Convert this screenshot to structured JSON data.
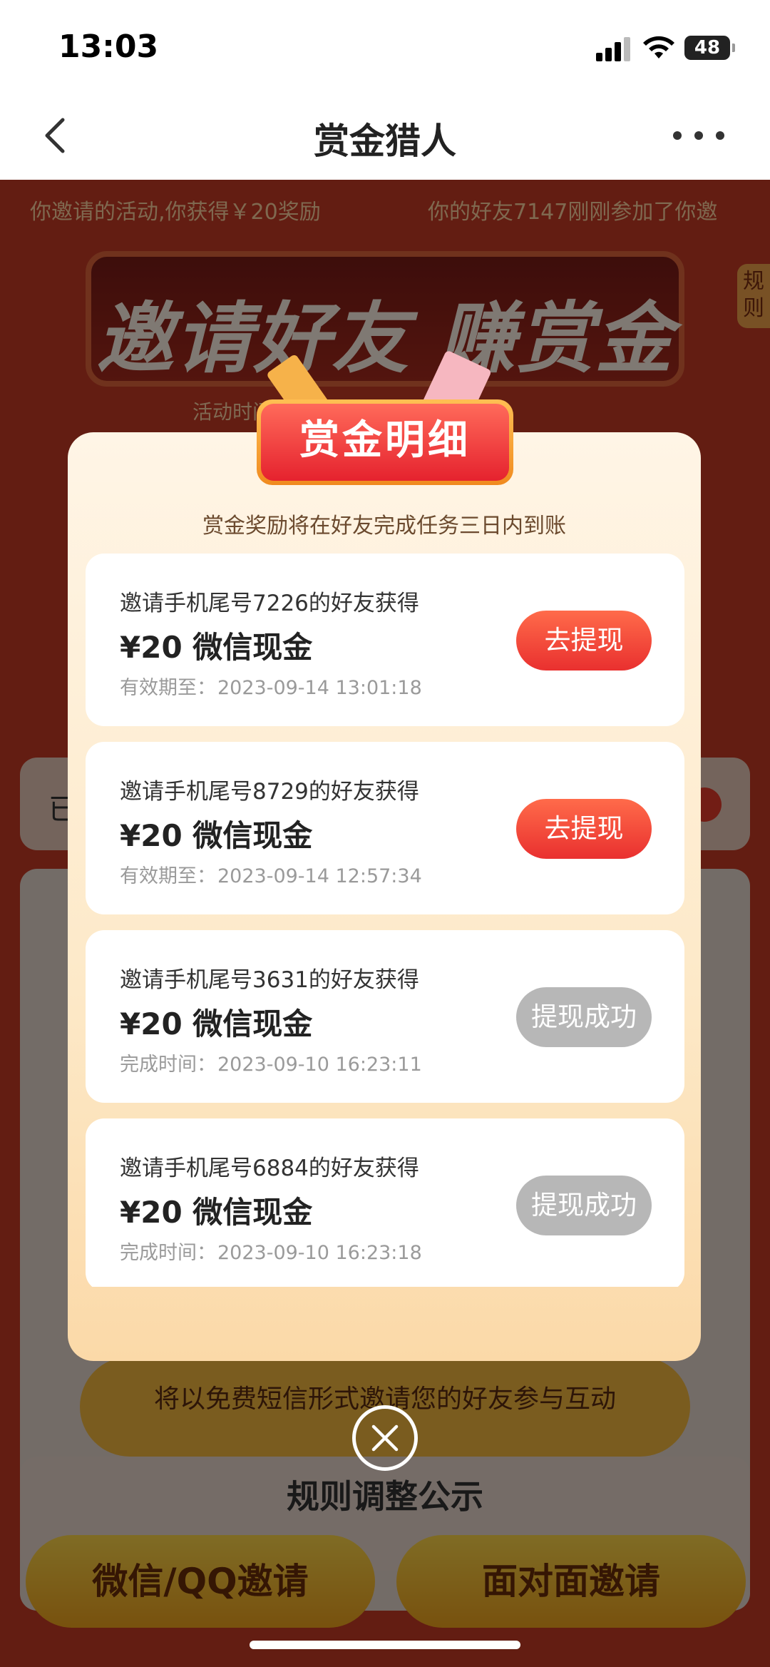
{
  "status_bar": {
    "time": "13:03",
    "battery": "48"
  },
  "nav": {
    "title": "赏金猎人"
  },
  "background": {
    "ticker": [
      "你邀请的活动,你获得￥20奖励",
      "你的好友7147刚刚参加了你邀"
    ],
    "rules_tab": "规则",
    "banner_title": "邀请好友 赚赏金",
    "activity_time": "活动时间 2023-09-      -09-29",
    "card_text": "已",
    "invite_hint": "将以免费短信形式邀请您的好友参与互动",
    "rules_notice": "规则调整公示",
    "wechat_button": "微信/QQ邀请",
    "face_button": "面对面邀请"
  },
  "modal": {
    "title": "赏金明细",
    "subtitle": "赏金奖励将在好友完成任务三日内到账",
    "items": [
      {
        "label": "邀请手机尾号7226的好友获得",
        "amount": "¥20 微信现金",
        "time_label": "有效期至：",
        "time": "2023-09-14 13:01:18",
        "button": "去提现",
        "status": "pending"
      },
      {
        "label": "邀请手机尾号8729的好友获得",
        "amount": "¥20 微信现金",
        "time_label": "有效期至：",
        "time": "2023-09-14 12:57:34",
        "button": "去提现",
        "status": "pending"
      },
      {
        "label": "邀请手机尾号3631的好友获得",
        "amount": "¥20 微信现金",
        "time_label": "完成时间：",
        "time": "2023-09-10 16:23:11",
        "button": "提现成功",
        "status": "done"
      },
      {
        "label": "邀请手机尾号6884的好友获得",
        "amount": "¥20 微信现金",
        "time_label": "完成时间：",
        "time": "2023-09-10 16:23:18",
        "button": "提现成功",
        "status": "done"
      }
    ]
  },
  "colors": {
    "accent": "#e9302f",
    "done": "#b7b7b7",
    "page_bg": "#c63a24"
  }
}
